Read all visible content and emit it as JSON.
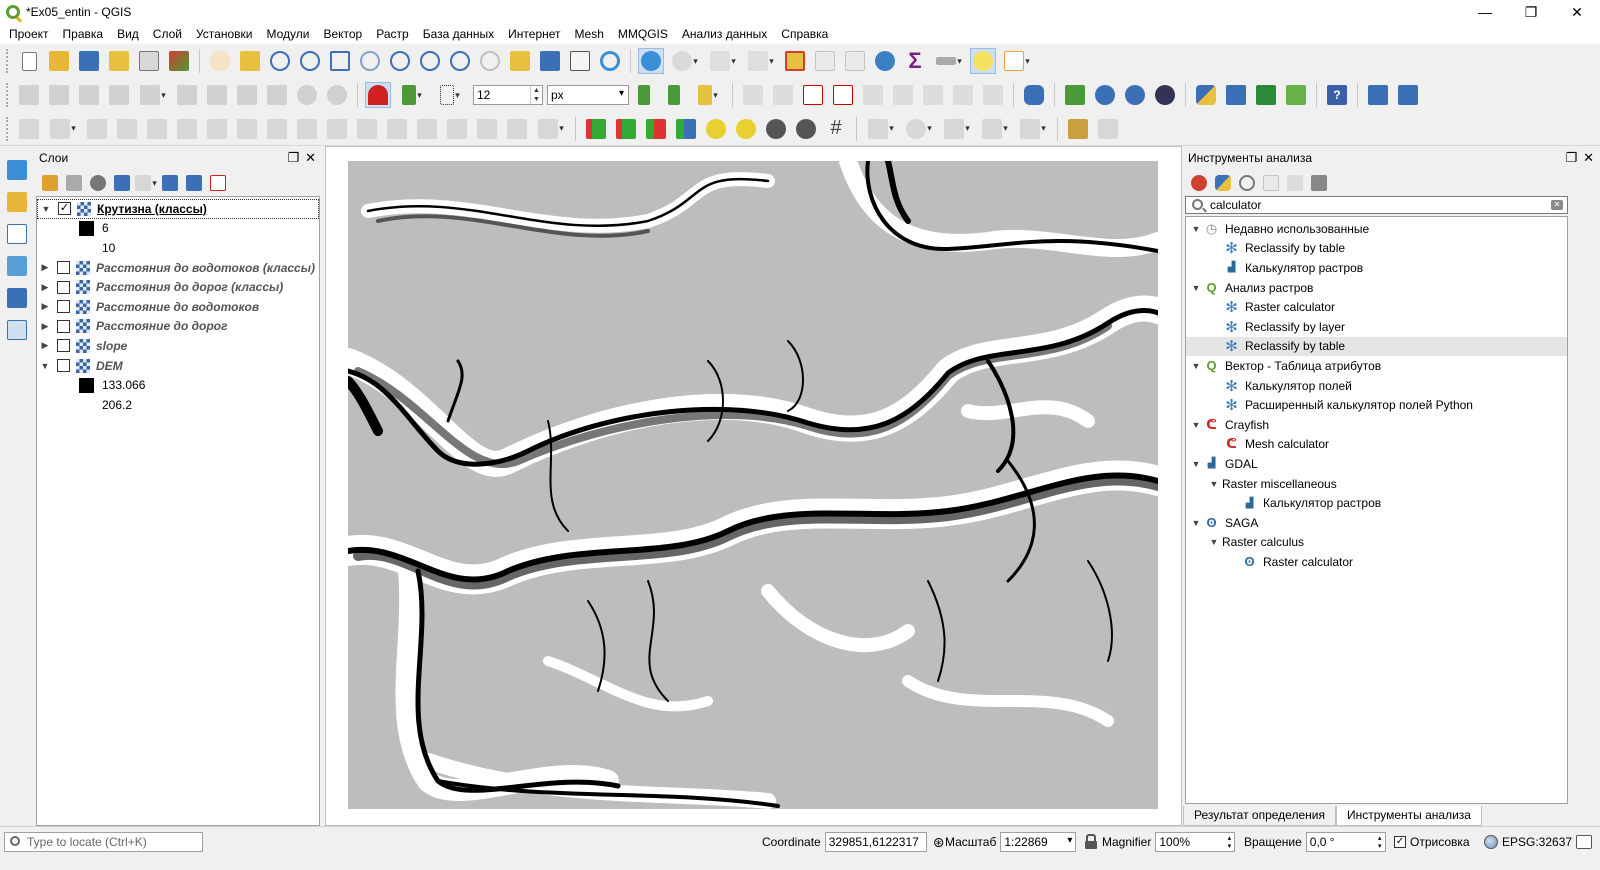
{
  "window": {
    "title": "*Ex05_entin - QGIS",
    "minimize": "—",
    "maximize": "❐",
    "close": "✕"
  },
  "menu": [
    "Проект",
    "Правка",
    "Вид",
    "Слой",
    "Установки",
    "Модули",
    "Вектор",
    "Растр",
    "База данных",
    "Интернет",
    "Mesh",
    "MMQGIS",
    "Анализ данных",
    "Справка"
  ],
  "toolbar2": {
    "snap_tolerance": "12",
    "snap_units": "px"
  },
  "layers_panel": {
    "title": "Слои",
    "layers": [
      {
        "name": "Крутизна (классы)",
        "checked": true,
        "expanded": true,
        "selected": true,
        "legend": [
          {
            "label": "6",
            "color": "#000000"
          },
          {
            "label": "10",
            "color": ""
          }
        ]
      },
      {
        "name": "Расстояния до водотоков (классы)",
        "checked": false,
        "expanded": false
      },
      {
        "name": "Расстояния до дорог (классы)",
        "checked": false,
        "expanded": false
      },
      {
        "name": "Расстояние до водотоков",
        "checked": false,
        "expanded": false
      },
      {
        "name": "Расстояние до дорог",
        "checked": false,
        "expanded": false
      },
      {
        "name": "slope",
        "checked": false,
        "expanded": false
      },
      {
        "name": "DEM",
        "checked": false,
        "expanded": true,
        "legend": [
          {
            "label": "133.066",
            "color": "#000000"
          },
          {
            "label": "206.2",
            "color": ""
          }
        ]
      }
    ]
  },
  "toolbox_panel": {
    "title": "Инструменты анализа",
    "search_value": "calculator",
    "tree": [
      {
        "level": 0,
        "label": "Недавно использованные",
        "icon": "clock-icon",
        "expanded": true
      },
      {
        "level": 1,
        "label": "Reclassify by table",
        "icon": "gear-icon"
      },
      {
        "level": 1,
        "label": "Калькулятор растров",
        "icon": "gdal-icon"
      },
      {
        "level": 0,
        "label": "Анализ растров",
        "icon": "qgis-icon",
        "expanded": true
      },
      {
        "level": 1,
        "label": "Raster calculator",
        "icon": "gear-icon"
      },
      {
        "level": 1,
        "label": "Reclassify by layer",
        "icon": "gear-icon"
      },
      {
        "level": 1,
        "label": "Reclassify by table",
        "icon": "gear-icon",
        "highlight": true
      },
      {
        "level": 0,
        "label": "Вектор - Таблица атрибутов",
        "icon": "qgis-icon",
        "expanded": true
      },
      {
        "level": 1,
        "label": "Калькулятор полей",
        "icon": "gear-icon"
      },
      {
        "level": 1,
        "label": "Расширенный калькулятор полей Python",
        "icon": "gear-icon"
      },
      {
        "level": 0,
        "label": "Crayfish",
        "icon": "crayfish-icon",
        "expanded": true
      },
      {
        "level": 1,
        "label": "Mesh calculator",
        "icon": "crayfish-icon"
      },
      {
        "level": 0,
        "label": "GDAL",
        "icon": "gdal-icon",
        "expanded": true
      },
      {
        "level": 0.5,
        "label": "Raster miscellaneous",
        "icon": "",
        "expanded": true
      },
      {
        "level": 2,
        "label": "Калькулятор растров",
        "icon": "gdal-icon"
      },
      {
        "level": 0,
        "label": "SAGA",
        "icon": "saga-icon",
        "expanded": true
      },
      {
        "level": 0.5,
        "label": "Raster calculus",
        "icon": "",
        "expanded": true
      },
      {
        "level": 2,
        "label": "Raster calculator",
        "icon": "saga-icon"
      }
    ],
    "tabs": [
      {
        "label": "Результат определения",
        "active": false
      },
      {
        "label": "Инструменты анализа",
        "active": true
      }
    ]
  },
  "statusbar": {
    "locate_placeholder": "Type to locate (Ctrl+K)",
    "coordinate_label": "Coordinate",
    "coordinate_value": "329851,6122317",
    "scale_label": "Масштаб",
    "scale_value": "1:22869",
    "magnifier_label": "Magnifier",
    "magnifier_value": "100%",
    "rotation_label": "Вращение",
    "rotation_value": "0,0 °",
    "render_label": "Отрисовка",
    "crs_label": "EPSG:32637"
  },
  "colors": {
    "map_background": "#bdbdbd",
    "highlight_row": "#e5e5e5",
    "accent": "#3d7fc4"
  }
}
